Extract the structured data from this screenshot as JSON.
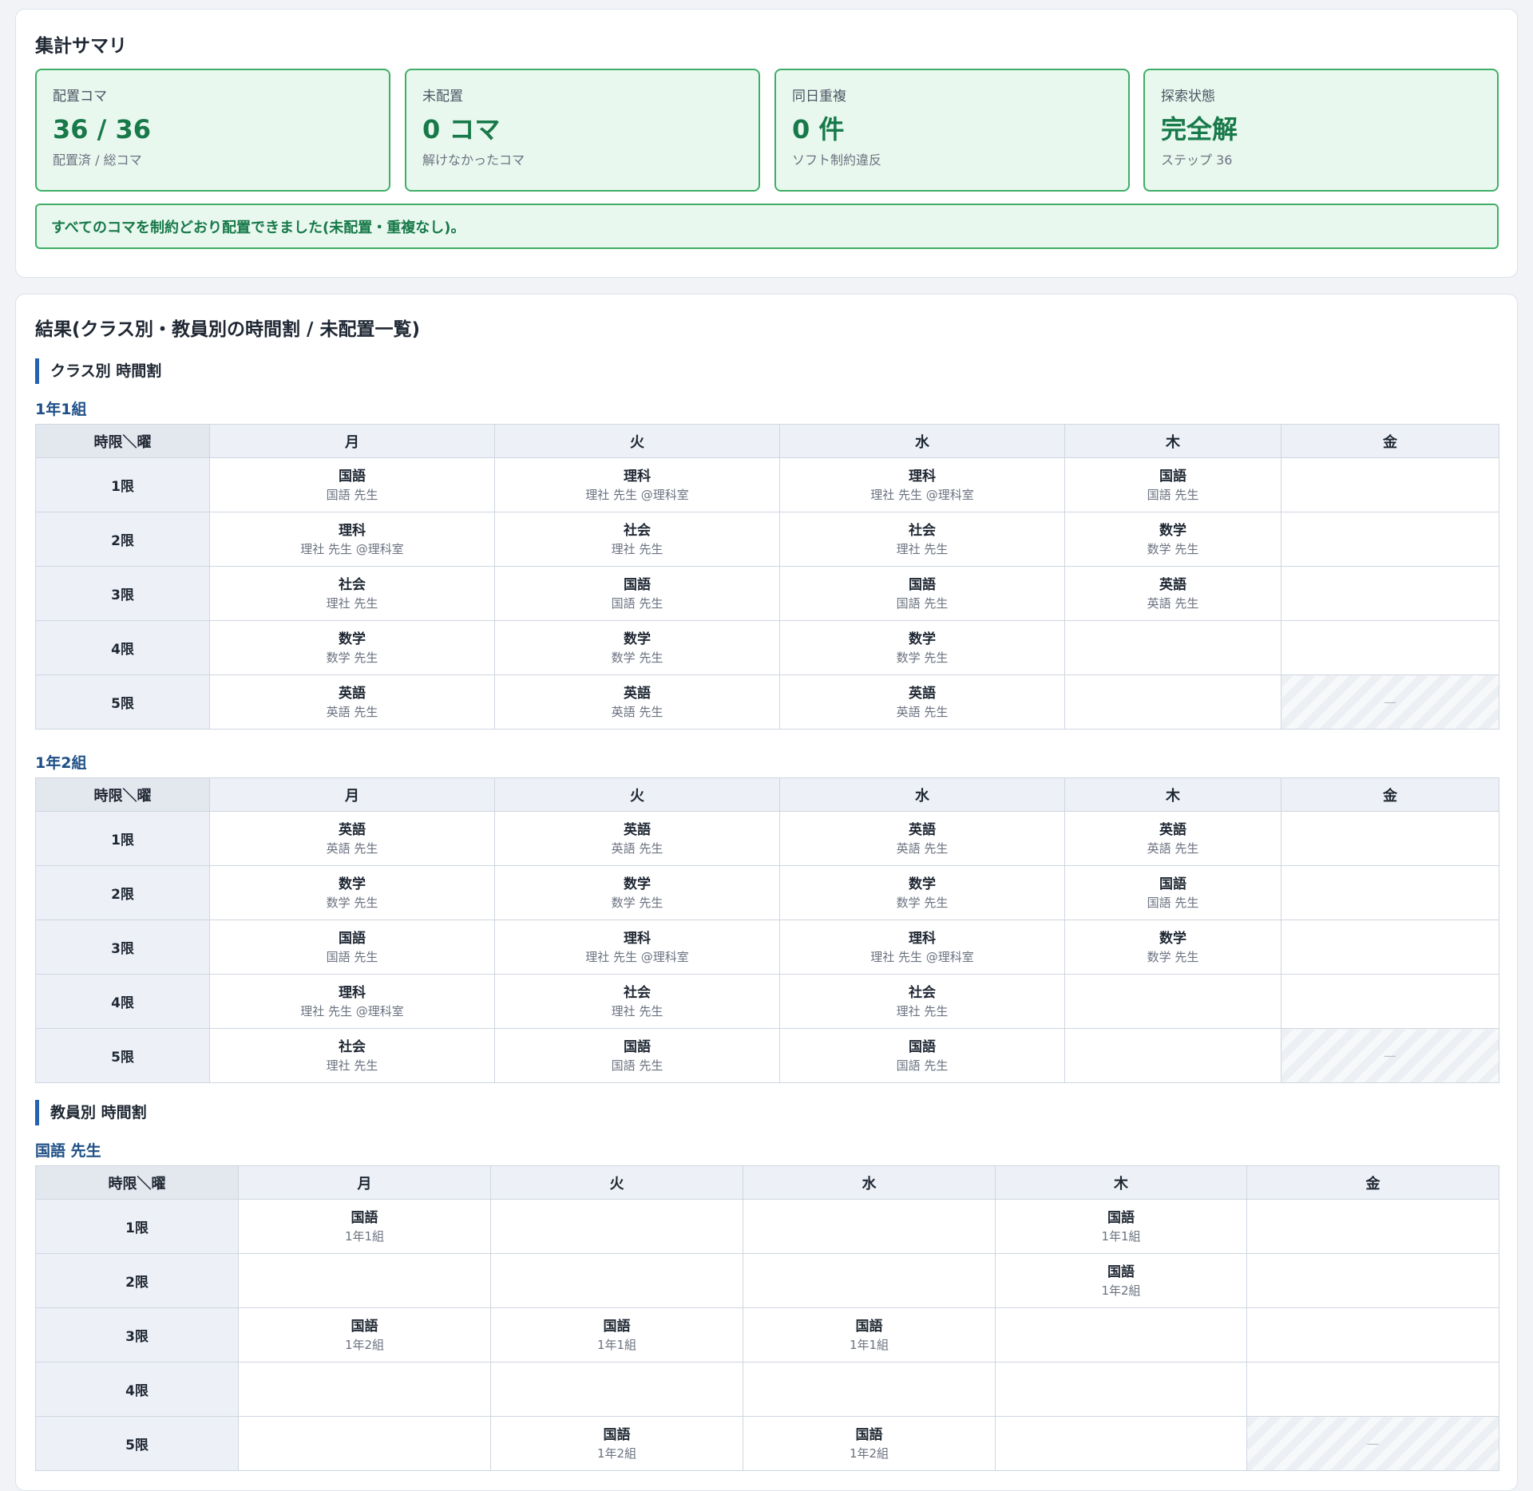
{
  "summary": {
    "title": "集計サマリ",
    "cards": [
      {
        "label": "配置コマ",
        "value": "36 / 36",
        "sub": "配置済 / 総コマ"
      },
      {
        "label": "未配置",
        "value": "0 コマ",
        "sub": "解けなかったコマ"
      },
      {
        "label": "同日重複",
        "value": "0 件",
        "sub": "ソフト制約違反"
      },
      {
        "label": "探索状態",
        "value": "完全解",
        "sub": "ステップ 36"
      }
    ],
    "notice": "すべてのコマを制約どおり配置できました(未配置・重複なし)。"
  },
  "results": {
    "title": "結果(クラス別・教員別の時間割 / 未配置一覧)",
    "class_heading": "クラス別 時間割",
    "teacher_heading": "教員別 時間割",
    "corner": "時限＼曜",
    "days": [
      "月",
      "火",
      "水",
      "木",
      "金"
    ],
    "periods": [
      "1限",
      "2限",
      "3限",
      "4限",
      "5限"
    ],
    "blocked_mark": "—",
    "classes": [
      {
        "name": "1年1組",
        "rows": [
          [
            {
              "s": "国語",
              "w": "国語 先生"
            },
            {
              "s": "理科",
              "w": "理社 先生 @理科室"
            },
            {
              "s": "理科",
              "w": "理社 先生 @理科室"
            },
            {
              "s": "国語",
              "w": "国語 先生"
            },
            null
          ],
          [
            {
              "s": "理科",
              "w": "理社 先生 @理科室"
            },
            {
              "s": "社会",
              "w": "理社 先生"
            },
            {
              "s": "社会",
              "w": "理社 先生"
            },
            {
              "s": "数学",
              "w": "数学 先生"
            },
            null
          ],
          [
            {
              "s": "社会",
              "w": "理社 先生"
            },
            {
              "s": "国語",
              "w": "国語 先生"
            },
            {
              "s": "国語",
              "w": "国語 先生"
            },
            {
              "s": "英語",
              "w": "英語 先生"
            },
            null
          ],
          [
            {
              "s": "数学",
              "w": "数学 先生"
            },
            {
              "s": "数学",
              "w": "数学 先生"
            },
            {
              "s": "数学",
              "w": "数学 先生"
            },
            null,
            null
          ],
          [
            {
              "s": "英語",
              "w": "英語 先生"
            },
            {
              "s": "英語",
              "w": "英語 先生"
            },
            {
              "s": "英語",
              "w": "英語 先生"
            },
            null,
            "blocked"
          ]
        ]
      },
      {
        "name": "1年2組",
        "rows": [
          [
            {
              "s": "英語",
              "w": "英語 先生"
            },
            {
              "s": "英語",
              "w": "英語 先生"
            },
            {
              "s": "英語",
              "w": "英語 先生"
            },
            {
              "s": "英語",
              "w": "英語 先生"
            },
            null
          ],
          [
            {
              "s": "数学",
              "w": "数学 先生"
            },
            {
              "s": "数学",
              "w": "数学 先生"
            },
            {
              "s": "数学",
              "w": "数学 先生"
            },
            {
              "s": "国語",
              "w": "国語 先生"
            },
            null
          ],
          [
            {
              "s": "国語",
              "w": "国語 先生"
            },
            {
              "s": "理科",
              "w": "理社 先生 @理科室"
            },
            {
              "s": "理科",
              "w": "理社 先生 @理科室"
            },
            {
              "s": "数学",
              "w": "数学 先生"
            },
            null
          ],
          [
            {
              "s": "理科",
              "w": "理社 先生 @理科室"
            },
            {
              "s": "社会",
              "w": "理社 先生"
            },
            {
              "s": "社会",
              "w": "理社 先生"
            },
            null,
            null
          ],
          [
            {
              "s": "社会",
              "w": "理社 先生"
            },
            {
              "s": "国語",
              "w": "国語 先生"
            },
            {
              "s": "国語",
              "w": "国語 先生"
            },
            null,
            "blocked"
          ]
        ]
      }
    ],
    "teachers": [
      {
        "name": "国語 先生",
        "rows": [
          [
            {
              "s": "国語",
              "w": "1年1組"
            },
            null,
            null,
            {
              "s": "国語",
              "w": "1年1組"
            },
            null
          ],
          [
            null,
            null,
            null,
            {
              "s": "国語",
              "w": "1年2組"
            },
            null
          ],
          [
            {
              "s": "国語",
              "w": "1年2組"
            },
            {
              "s": "国語",
              "w": "1年1組"
            },
            {
              "s": "国語",
              "w": "1年1組"
            },
            null,
            null
          ],
          [
            null,
            null,
            null,
            null,
            null
          ],
          [
            null,
            {
              "s": "国語",
              "w": "1年2組"
            },
            {
              "s": "国語",
              "w": "1年2組"
            },
            null,
            "blocked"
          ]
        ]
      }
    ]
  }
}
